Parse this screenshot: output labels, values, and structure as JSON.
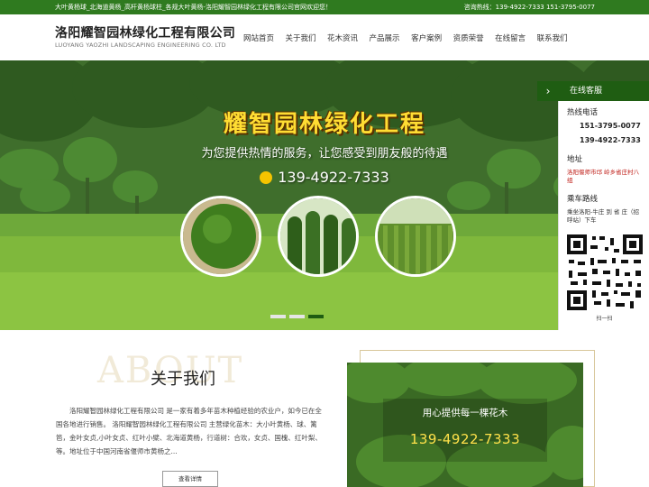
{
  "topbar": {
    "tagline": "大叶黄杨球_北海道黄杨_高杆黄杨球柱_各规大叶黄杨-洛阳耀智园林绿化工程有限公司官网欢迎您！",
    "hotline": "咨询热线：139-4922-7333 151-3795-0077"
  },
  "header": {
    "company_name": "洛阳耀智园林绿化工程有限公司",
    "company_name_en": "LUOYANG YAOZHI LANDSCAPING ENGINEERING CO. LTD"
  },
  "nav": {
    "items": [
      {
        "label": "网站首页"
      },
      {
        "label": "关于我们"
      },
      {
        "label": "花木资讯"
      },
      {
        "label": "产品展示"
      },
      {
        "label": "客户案例"
      },
      {
        "label": "资质荣誉"
      },
      {
        "label": "在线留言"
      },
      {
        "label": "联系我们"
      }
    ]
  },
  "banner": {
    "title": "耀智园林绿化工程",
    "subtitle": "为您提供热情的服务，让您感受到朋友般的待遇",
    "phone": "139-4922-7333",
    "slides_total": 3,
    "active_slide": 3
  },
  "service": {
    "header": "在线客服",
    "arrow": "›",
    "hotline_label": "热线电话",
    "phone1": "151-3795-0077",
    "phone2": "139-4922-7333",
    "address_label": "地址",
    "address": "洛阳偃师市邙 岭乡省庄村八组",
    "route_label": "乘车路线",
    "route": "乘坐洛阳-牛庄 到 省 庄（招呼站）下车",
    "qr_caption": "扫一扫"
  },
  "about": {
    "bg_word": "ABOUT",
    "title": "关于我们",
    "text": "洛阳耀智园林绿化工程有限公司 是一家有着多年苗木种植经验的农业户，如今已在全国各地进行销售。 洛阳耀智园林绿化工程有限公司 主营绿化苗木：大小叶黄杨、球、篱笆，金叶女贞,小叶女贞、红叶小檗、北海道黄杨，行道树：合欢，女贞、国槐、红叶梨、等。地址位于中国河南省偃师市黄杨之...",
    "button": "查看详情",
    "img_caption": "用心提供每一棵花木",
    "img_phone": "139-4922-7333"
  },
  "colors": {
    "brand_green": "#1f5d12",
    "topbar_green": "#2f7a1f",
    "banner_title": "#ffdd33"
  }
}
